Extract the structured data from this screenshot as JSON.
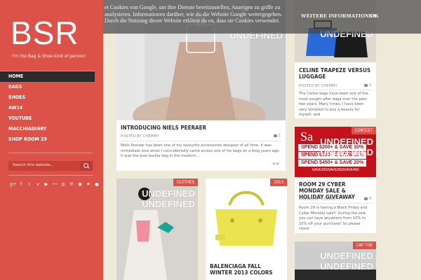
{
  "sidebar": {
    "logo": "BSR",
    "tagline": "I'm the Bag & Shoe kind of person!",
    "nav": [
      "HOME",
      "BAGS",
      "SHOES",
      "AW14",
      "YOUTUBE",
      "MACCHIADIARY",
      "SHOP ROOM 29"
    ],
    "search_placeholder": "Search this website...",
    "social_icons": [
      "google-plus-icon",
      "facebook-icon",
      "twitter-icon",
      "vine-icon",
      "youtube-icon",
      "flickr-icon",
      "instagram-icon",
      "pinterest-icon",
      "rss-icon",
      "lastfm-icon",
      "tumblr-icon"
    ],
    "social_glyphs": [
      "g+",
      "f",
      "t",
      "v",
      "▶",
      "••",
      "◎",
      "℗",
      "◉",
      "✷",
      "●"
    ]
  },
  "cookie": {
    "text": "et Cookies von Google, um ihre Dienste bereitzustellen, Anzeigen zu griffe zu analysieren. Informationen darüber, wie du die Website Google weitergegeben. Durch die Nutzung dieser Website erklärst du en, dass sie Cookies verwendet.",
    "more_label": "WEITERE INFORMATIONEN",
    "ok_label": "OK"
  },
  "posts": [
    {
      "title": "INTRODUCING NIELS PEERAER",
      "meta": "POSTED BY CHEMMY",
      "comments": "1",
      "excerpt": "Niels Peeraer has been one of my favourite accessories designer of all time. It was immediate love when I coincidentally came across one of his bags on a blog years ago. It was the bow buckle bag in the medium...",
      "overlay": "UNDEFINED",
      "read_more": "»»"
    },
    {
      "title": "CELINE TRAPEZE VERSUS LUGGAGE",
      "meta": "POSTED BY CHEMMY",
      "comments": "0",
      "excerpt": "The Celine bags have been one of the most sought after bags over the past few years. Many times, I have been very tempted to buy a beauty for myself, and",
      "overlay": "UNDEFINED"
    },
    {
      "title": "ROOM 29 CYBER MONDAY SALE & HOLIDAY GIVEAWAY",
      "meta": "POSTED BY CHEMMY",
      "comments": "0",
      "badge": "CONTEST",
      "excerpt": "Room 29 is having a Black Friday and Cyber Monday sale!! During the sale you can save anywhere from 10% to 20% off your purchase! So please check",
      "overlay": [
        "UNDEFINED",
        "UNDEFINED"
      ],
      "sale": {
        "headline": "Sa",
        "lines": [
          "SPEND $200+ & SAVE 10%",
          "SPEND $300+ & SAVE 15%",
          "SPEND $450+ & SAVE 20%"
        ],
        "small": "SAVE200/SAVE350/SAVE450"
      }
    },
    {
      "title": "",
      "badge": "CLOTHES",
      "overlay": [
        "UNDEFINED",
        "UNDEFINED"
      ]
    },
    {
      "title": "BALENCIAGA FALL WINTER 2013 COLORS",
      "badge": "2013"
    },
    {
      "title": "",
      "badge": "CAP TOE",
      "overlay": [
        "UNDEFINED",
        "UNDEFINED"
      ]
    }
  ],
  "colors": {
    "brand": "#dc5148",
    "background": "#efe9d9",
    "nav_active": "#2b2b2b",
    "accent": "#b0121a"
  }
}
